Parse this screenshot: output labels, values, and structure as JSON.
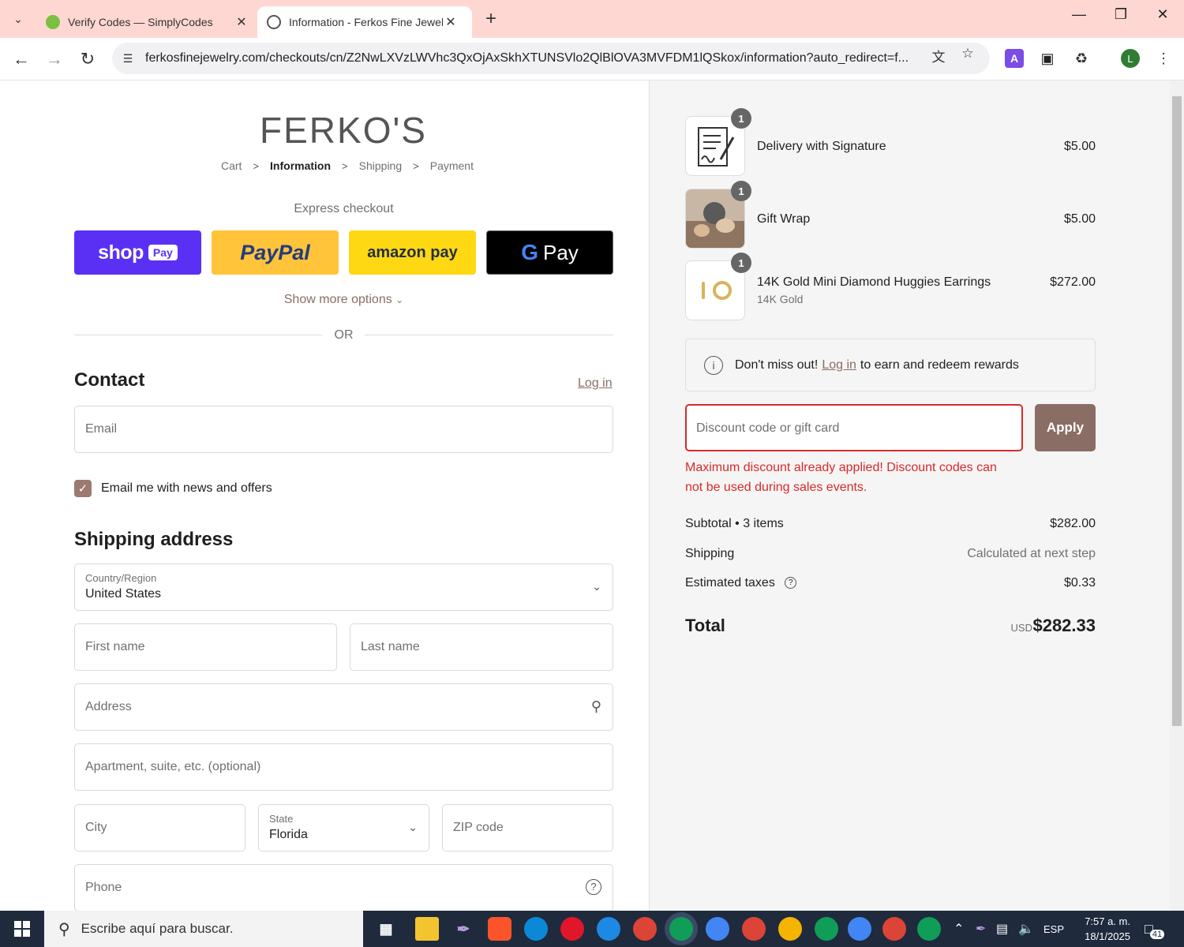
{
  "browser": {
    "tabs": [
      {
        "title": "Verify Codes — SimplyCodes",
        "close": "✕"
      },
      {
        "title": "Information - Ferkos Fine Jewelry",
        "close": "✕"
      }
    ],
    "new_tab": "+",
    "url": "ferkosfinejewelry.com/checkouts/cn/Z2NwLXVzLWVhc3QxOjAxSkhXTUNSVlo2QlBlOVA3MVFDM1lQSkox/information?auto_redirect=f...",
    "profile_initial": "L"
  },
  "store": {
    "logo": "FERKO'S"
  },
  "breadcrumb": {
    "cart": "Cart",
    "information": "Information",
    "shipping": "Shipping",
    "payment": "Payment",
    "sep": ">"
  },
  "express": {
    "label": "Express checkout",
    "shop": "shop",
    "shop_badge": "Pay",
    "paypal": "PayPal",
    "amazon": "amazon pay",
    "gpay": "Pay",
    "show_more": "Show more options"
  },
  "or_label": "OR",
  "contact": {
    "heading": "Contact",
    "login": "Log in",
    "email_placeholder": "Email",
    "newsletter_label": "Email me with news and offers",
    "newsletter_checked": true
  },
  "shipping_address": {
    "heading": "Shipping address",
    "country_label": "Country/Region",
    "country_value": "United States",
    "first_name": "First name",
    "last_name": "Last name",
    "address": "Address",
    "apartment": "Apartment, suite, etc. (optional)",
    "city": "City",
    "state_label": "State",
    "state_value": "Florida",
    "zip": "ZIP code",
    "phone": "Phone"
  },
  "order": {
    "items": [
      {
        "qty": "1",
        "name": "Delivery with Signature",
        "variant": "",
        "price": "$5.00"
      },
      {
        "qty": "1",
        "name": "Gift Wrap",
        "variant": "",
        "price": "$5.00"
      },
      {
        "qty": "1",
        "name": "14K Gold Mini Diamond Huggies Earrings",
        "variant": "14K Gold",
        "price": "$272.00"
      }
    ],
    "rewards_prefix": "Don't miss out!",
    "rewards_link": "Log in",
    "rewards_suffix": "to earn and redeem rewards",
    "discount_placeholder": "Discount code or gift card",
    "apply": "Apply",
    "discount_error": "Maximum discount already applied! Discount codes can not be used during sales events.",
    "subtotal_label": "Subtotal • 3 items",
    "subtotal_value": "$282.00",
    "shipping_label": "Shipping",
    "shipping_value": "Calculated at next step",
    "taxes_label": "Estimated taxes",
    "taxes_value": "$0.33",
    "total_label": "Total",
    "total_currency": "USD",
    "total_value": "$282.33"
  },
  "taskbar": {
    "search_placeholder": "Escribe aquí para buscar.",
    "language": "ESP",
    "time": "7:57 a. m.",
    "date": "18/1/2025",
    "notifications": "41"
  },
  "colors": {
    "accent": "#8a6d65",
    "error": "#d82a2a",
    "shop_pay": "#5a31f4",
    "paypal": "#ffc439",
    "amazon": "#ffd814",
    "tabstrip": "#ffd7d2"
  }
}
